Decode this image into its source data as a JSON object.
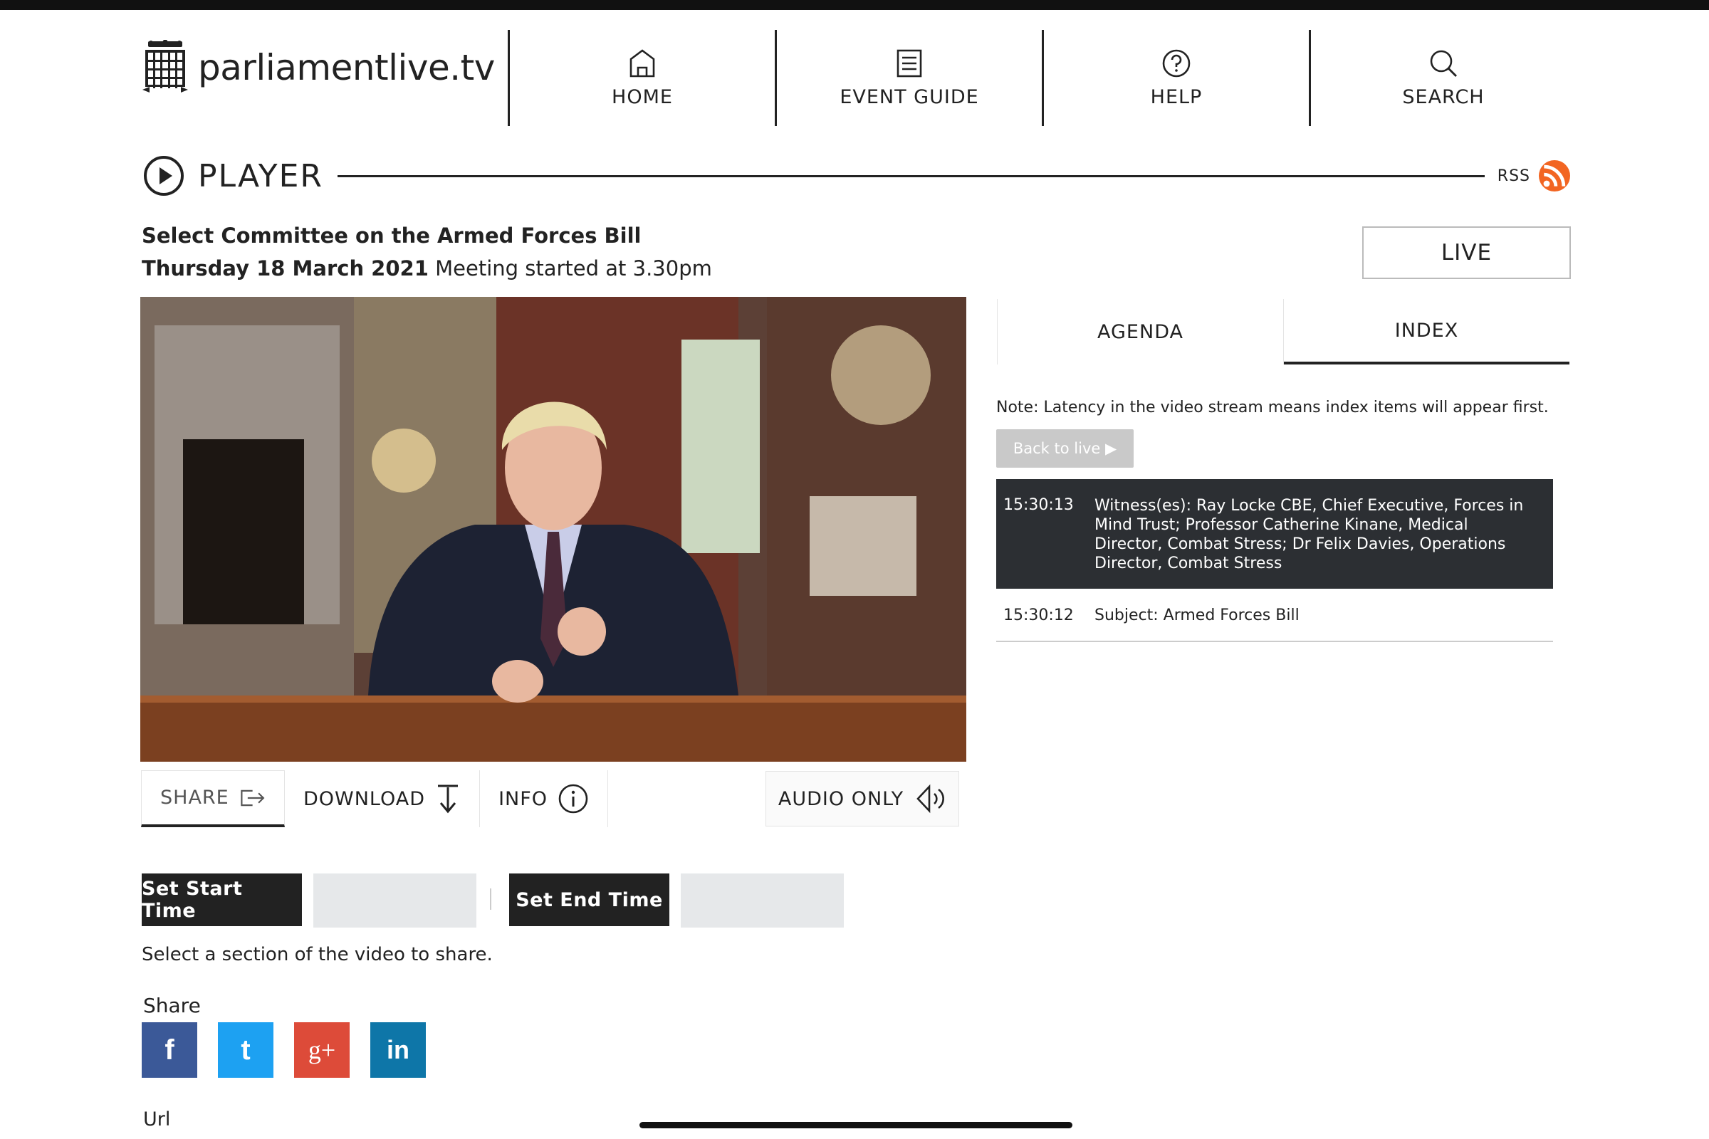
{
  "header": {
    "logo_text": "parliamentlive.tv",
    "nav": [
      {
        "label": "HOME",
        "icon": "home-icon"
      },
      {
        "label": "EVENT GUIDE",
        "icon": "document-icon"
      },
      {
        "label": "HELP",
        "icon": "help-icon"
      },
      {
        "label": "SEARCH",
        "icon": "search-icon"
      }
    ]
  },
  "player": {
    "heading": "PLAYER",
    "rss_label": "RSS",
    "meeting_title": "Select Committee on the Armed Forces Bill",
    "meeting_date": "Thursday 18 March 2021",
    "meeting_start": "Meeting started at 3.30pm",
    "live_label": "LIVE"
  },
  "controls": {
    "share": "SHARE",
    "download": "DOWNLOAD",
    "info": "INFO",
    "audio_only": "AUDIO ONLY"
  },
  "clip": {
    "set_start": "Set Start Time",
    "set_end": "Set End Time",
    "start_value": "",
    "end_value": "",
    "hint": "Select a section of the video to share."
  },
  "share": {
    "label": "Share",
    "networks": [
      {
        "name": "facebook",
        "glyph": "f",
        "color": "#3b5998"
      },
      {
        "name": "twitter",
        "glyph": "t",
        "color": "#1da1f2"
      },
      {
        "name": "google-plus",
        "glyph": "g+",
        "color": "#dd4b39"
      },
      {
        "name": "linkedin",
        "glyph": "in",
        "color": "#0e76a8"
      }
    ],
    "url_label": "Url"
  },
  "sidebar": {
    "tabs": [
      "AGENDA",
      "INDEX"
    ],
    "active_tab": "INDEX",
    "note": "Note: Latency in the video stream means index items will appear first.",
    "back_to_live": "Back to live ▶",
    "index_items": [
      {
        "time": "15:30:13",
        "text": "Witness(es): Ray Locke CBE, Chief Executive, Forces in Mind Trust; Professor Catherine Kinane, Medical Director, Combat Stress; Dr Felix Davies, Operations Director, Combat Stress"
      },
      {
        "time": "15:30:12",
        "text": "Subject: Armed Forces Bill"
      }
    ]
  },
  "colors": {
    "rss": "#f26522",
    "dark_button": "#222222",
    "active_index_bg": "#2c2f33"
  }
}
